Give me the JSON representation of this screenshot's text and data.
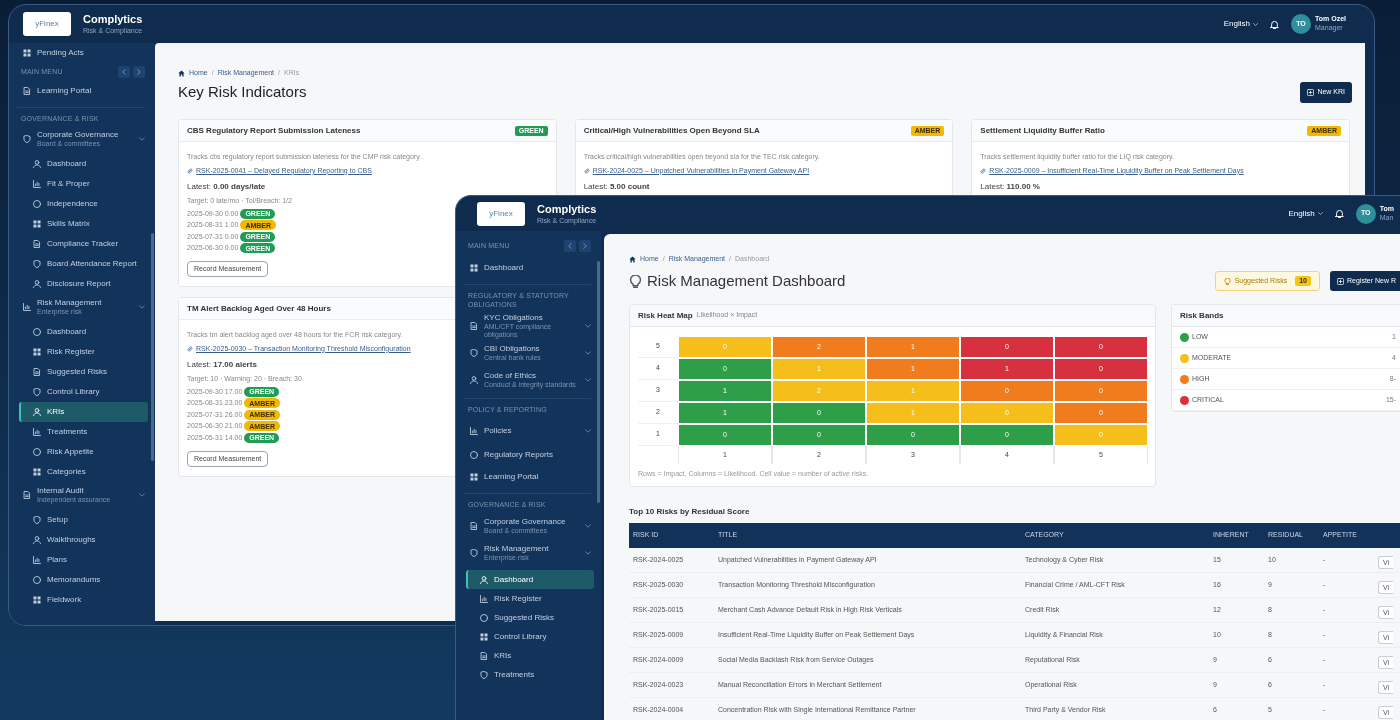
{
  "back_window": {
    "header": {
      "logo": "yFinex",
      "app_name": "Complytics",
      "tagline": "Risk & Compliance",
      "language": "English",
      "avatar_initials": "TO",
      "user_name": "Tom Ozel",
      "user_role": "Manager"
    },
    "sidebar": [
      {
        "kind": "link",
        "label": "Pending Acts",
        "selected": false
      },
      {
        "kind": "menu_header",
        "label": "MAIN MENU"
      },
      {
        "kind": "link",
        "label": "Learning Portal",
        "selected": false
      },
      {
        "kind": "section",
        "label": "GOVERNANCE & RISK"
      },
      {
        "kind": "group",
        "label": "Corporate Governance",
        "subtitle": "Board & committees",
        "selected": false,
        "children": [
          {
            "label": "Dashboard",
            "selected": false
          },
          {
            "label": "Fit & Proper",
            "selected": false
          },
          {
            "label": "Independence",
            "selected": false
          },
          {
            "label": "Skills Matrix",
            "selected": false
          },
          {
            "label": "Compliance Tracker",
            "selected": false
          },
          {
            "label": "Board Attendance Report",
            "selected": false
          },
          {
            "label": "Disclosure Report",
            "selected": false
          }
        ]
      },
      {
        "kind": "group",
        "label": "Risk Management",
        "subtitle": "Enterprise risk",
        "selected": false,
        "children": [
          {
            "label": "Dashboard",
            "selected": false
          },
          {
            "label": "Risk Register",
            "selected": false
          },
          {
            "label": "Suggested Risks",
            "selected": false
          },
          {
            "label": "Control Library",
            "selected": false
          },
          {
            "label": "KRIs",
            "selected": true
          },
          {
            "label": "Treatments",
            "selected": false
          },
          {
            "label": "Risk Appetite",
            "selected": false
          },
          {
            "label": "Categories",
            "selected": false
          }
        ]
      },
      {
        "kind": "group",
        "label": "Internal Audit",
        "subtitle": "Independent assurance",
        "selected": false,
        "children": [
          {
            "label": "Setup",
            "selected": false
          },
          {
            "label": "Walkthroughs",
            "selected": false
          },
          {
            "label": "Plans",
            "selected": false
          },
          {
            "label": "Memorandums",
            "selected": false
          },
          {
            "label": "Fieldwork",
            "selected": false
          }
        ]
      }
    ],
    "breadcrumb": {
      "separator": "/",
      "items": [
        "Home",
        "Risk Management",
        "KRIs"
      ]
    },
    "title": "Key Risk Indicators",
    "primary_button": "New KRI",
    "kri_cards": [
      {
        "title": "CBS Regulatory Report Submission Lateness",
        "badge": {
          "text": "GREEN",
          "color": "#1f9d55"
        },
        "description": "Tracks cbs regulatory report submission lateness for the CMP risk category.",
        "link": "RSK-2025-0041 – Delayed Regulatory Reporting to CBS",
        "latest": "Latest: **0.00 days/late**",
        "target": "Target: 0 late/mo · Tol/Breach: 1/2",
        "measurements": [
          {
            "text": "2025-09-30 0.00",
            "badge": {
              "text": "GREEN",
              "color": "#1f9d55"
            }
          },
          {
            "text": "2025-08-31 1.00",
            "badge": {
              "text": "AMBER",
              "color": "#f5b800"
            }
          },
          {
            "text": "2025-07-31 0.00",
            "badge": {
              "text": "GREEN",
              "color": "#1f9d55"
            }
          },
          {
            "text": "2025-06-30 0.00",
            "badge": {
              "text": "GREEN",
              "color": "#1f9d55"
            }
          }
        ],
        "button": "Record Measurement"
      },
      {
        "title": "Critical/High Vulnerabilities Open Beyond SLA",
        "badge": {
          "text": "AMBER",
          "color": "#f5b800"
        },
        "description": "Tracks critical/high vulnerabilities open beyond sla for the TEC risk category.",
        "link": "RSK-2024-0025 – Unpatched Vulnerabilities in Payment Gateway API",
        "latest": "Latest: **5.00 count**"
      },
      {
        "title": "Settlement Liquidity Buffer Ratio",
        "badge": {
          "text": "AMBER",
          "color": "#f5b800"
        },
        "description": "Tracks settlement liquidity buffer ratio for the LIQ risk category.",
        "link": "RSK-2025-0009 – Insufficient Real-Time Liquidity Buffer on Peak Settlement Days",
        "latest": "Latest: **110.00 %**"
      },
      {
        "title": "TM Alert Backlog Aged Over 48 Hours",
        "description": "Tracks tm alert backlog aged over 48 hours for the FCR risk category.",
        "link": "RSK-2025-0030 – Transaction Monitoring Threshold Misconfiguration",
        "latest": "Latest: **17.00 alerts**",
        "target": "Target: 10 · Warning: 20 · Breach: 30",
        "measurements": [
          {
            "text": "2025-09-30 17.00",
            "badge": {
              "text": "GREEN",
              "color": "#1f9d55"
            }
          },
          {
            "text": "2025-08-31 23.00",
            "badge": {
              "text": "AMBER",
              "color": "#f5b800"
            }
          },
          {
            "text": "2025-07-31 26.00",
            "badge": {
              "text": "AMBER",
              "color": "#f5b800"
            }
          },
          {
            "text": "2025-06-30 21.00",
            "badge": {
              "text": "AMBER",
              "color": "#f5b800"
            }
          },
          {
            "text": "2025-05-31 14.00",
            "badge": {
              "text": "GREEN",
              "color": "#1f9d55"
            }
          }
        ],
        "button": "Record Measurement"
      }
    ]
  },
  "front_window": {
    "header": {
      "logo": "yFinex",
      "app_name": "Complytics",
      "tagline": "Risk & Compliance",
      "language": "English",
      "avatar_initials": "TO",
      "user_name": "Tom",
      "user_role": "Man"
    },
    "sidebar": [
      {
        "kind": "menu_header",
        "label": "MAIN MENU"
      },
      {
        "kind": "link",
        "label": "Dashboard",
        "selected": false
      },
      {
        "kind": "section",
        "label": "REGULATORY & STATUTORY OBLIGATIONS"
      },
      {
        "kind": "group",
        "label": "KYC Obligations",
        "subtitle": "AML/CFT compliance obligations",
        "selected": false
      },
      {
        "kind": "group",
        "label": "CBI Obligations",
        "subtitle": "Central bank rules",
        "selected": false
      },
      {
        "kind": "group",
        "label": "Code of Ethics",
        "subtitle": "Conduct & integrity standards",
        "selected": false
      },
      {
        "kind": "section",
        "label": "POLICY & REPORTING"
      },
      {
        "kind": "group",
        "label": "Policies",
        "selected": false
      },
      {
        "kind": "link",
        "label": "Regulatory Reports",
        "selected": false
      },
      {
        "kind": "link",
        "label": "Learning Portal",
        "selected": false
      },
      {
        "kind": "section",
        "label": "GOVERNANCE & RISK"
      },
      {
        "kind": "group",
        "label": "Corporate Governance",
        "subtitle": "Board & committees",
        "selected": false
      },
      {
        "kind": "group",
        "label": "Risk Management",
        "subtitle": "Enterprise risk",
        "selected": false,
        "children": [
          {
            "label": "Dashboard",
            "selected": true
          },
          {
            "label": "Risk Register",
            "selected": false
          },
          {
            "label": "Suggested Risks",
            "selected": false
          },
          {
            "label": "Control Library",
            "selected": false
          },
          {
            "label": "KRIs",
            "selected": false
          },
          {
            "label": "Treatments",
            "selected": false
          }
        ]
      }
    ],
    "breadcrumb": {
      "separator": "/",
      "items": [
        "Home",
        "Risk Management",
        "Dashboard"
      ]
    },
    "title": "Risk Management Dashboard",
    "suggested_button": {
      "label": "Suggested Risks",
      "count": "10"
    },
    "primary_button": "Register New R",
    "heat_map": {
      "title": "Risk Heat Map",
      "subtitle": "Likelihood × Impact",
      "rows": [
        {
          "label": "5",
          "cells": [
            {
              "value": "0",
              "color": "#f6be1a"
            },
            {
              "value": "2",
              "color": "#f07c1e"
            },
            {
              "value": "1",
              "color": "#f07c1e"
            },
            {
              "value": "0",
              "color": "#d7313f"
            },
            {
              "value": "0",
              "color": "#d7313f"
            }
          ]
        },
        {
          "label": "4",
          "cells": [
            {
              "value": "0",
              "color": "#2e9e48"
            },
            {
              "value": "1",
              "color": "#f6be1a"
            },
            {
              "value": "1",
              "color": "#f07c1e"
            },
            {
              "value": "1",
              "color": "#d7313f"
            },
            {
              "value": "0",
              "color": "#d7313f"
            }
          ]
        },
        {
          "label": "3",
          "cells": [
            {
              "value": "1",
              "color": "#2e9e48"
            },
            {
              "value": "2",
              "color": "#f6be1a"
            },
            {
              "value": "1",
              "color": "#f6be1a"
            },
            {
              "value": "0",
              "color": "#f07c1e"
            },
            {
              "value": "0",
              "color": "#f07c1e"
            }
          ]
        },
        {
          "label": "2",
          "cells": [
            {
              "value": "1",
              "color": "#2e9e48"
            },
            {
              "value": "0",
              "color": "#2e9e48"
            },
            {
              "value": "1",
              "color": "#f6be1a"
            },
            {
              "value": "0",
              "color": "#f6be1a"
            },
            {
              "value": "0",
              "color": "#f07c1e"
            }
          ]
        },
        {
          "label": "1",
          "cells": [
            {
              "value": "0",
              "color": "#2e9e48"
            },
            {
              "value": "0",
              "color": "#2e9e48"
            },
            {
              "value": "0",
              "color": "#2e9e48"
            },
            {
              "value": "0",
              "color": "#2e9e48"
            },
            {
              "value": "0",
              "color": "#f6be1a"
            }
          ]
        }
      ],
      "column_labels": [
        "1",
        "2",
        "3",
        "4",
        "5"
      ],
      "note": "Rows = Impact, Columns = Likelihood. Cell value = number of active risks."
    },
    "risk_bands": {
      "title": "Risk Bands",
      "bands": [
        {
          "label": "LOW",
          "range": "1",
          "color": "#2e9e48"
        },
        {
          "label": "MODERATE",
          "range": "4",
          "color": "#f6be1a"
        },
        {
          "label": "HIGH",
          "range": "8-",
          "color": "#f07c1e"
        },
        {
          "label": "CRITICAL",
          "range": "15-",
          "color": "#d7313f"
        }
      ]
    },
    "top_risks": {
      "title": "Top 10 Risks by Residual Score",
      "columns": [
        "RISK ID",
        "TITLE",
        "CATEGORY",
        "INHERENT",
        "RESIDUAL",
        "APPETITE"
      ],
      "rows": [
        {
          "cells": [
            "RSK-2024-0025",
            "Unpatched Vulnerabilities in Payment Gateway API",
            "Technology & Cyber Risk",
            "15",
            "10",
            "-"
          ],
          "action": "Vi"
        },
        {
          "cells": [
            "RSK-2025-0030",
            "Transaction Monitoring Threshold Misconfiguration",
            "Financial Crime / AML-CFT Risk",
            "16",
            "9",
            "-"
          ],
          "action": "Vi"
        },
        {
          "cells": [
            "RSK-2025-0015",
            "Merchant Cash Advance Default Risk in High Risk Verticals",
            "Credit Risk",
            "12",
            "8",
            "-"
          ],
          "action": "Vi"
        },
        {
          "cells": [
            "RSK-2025-0009",
            "Insufficient Real-Time Liquidity Buffer on Peak Settlement Days",
            "Liquidity & Financial Risk",
            "10",
            "8",
            "-"
          ],
          "action": "Vi"
        },
        {
          "cells": [
            "RSK-2024-0009",
            "Social Media Backlash Risk from Service Outages",
            "Reputational Risk",
            "9",
            "6",
            "-"
          ],
          "action": "Vi"
        },
        {
          "cells": [
            "RSK-2024-0023",
            "Manual Reconciliation Errors in Merchant Settlement",
            "Operational Risk",
            "9",
            "6",
            "-"
          ],
          "action": "Vi"
        },
        {
          "cells": [
            "RSK-2024-0004",
            "Concentration Risk with Single International Remittance Partner",
            "Third Party & Vendor Risk",
            "6",
            "5",
            "-"
          ],
          "action": "Vi"
        }
      ]
    }
  }
}
